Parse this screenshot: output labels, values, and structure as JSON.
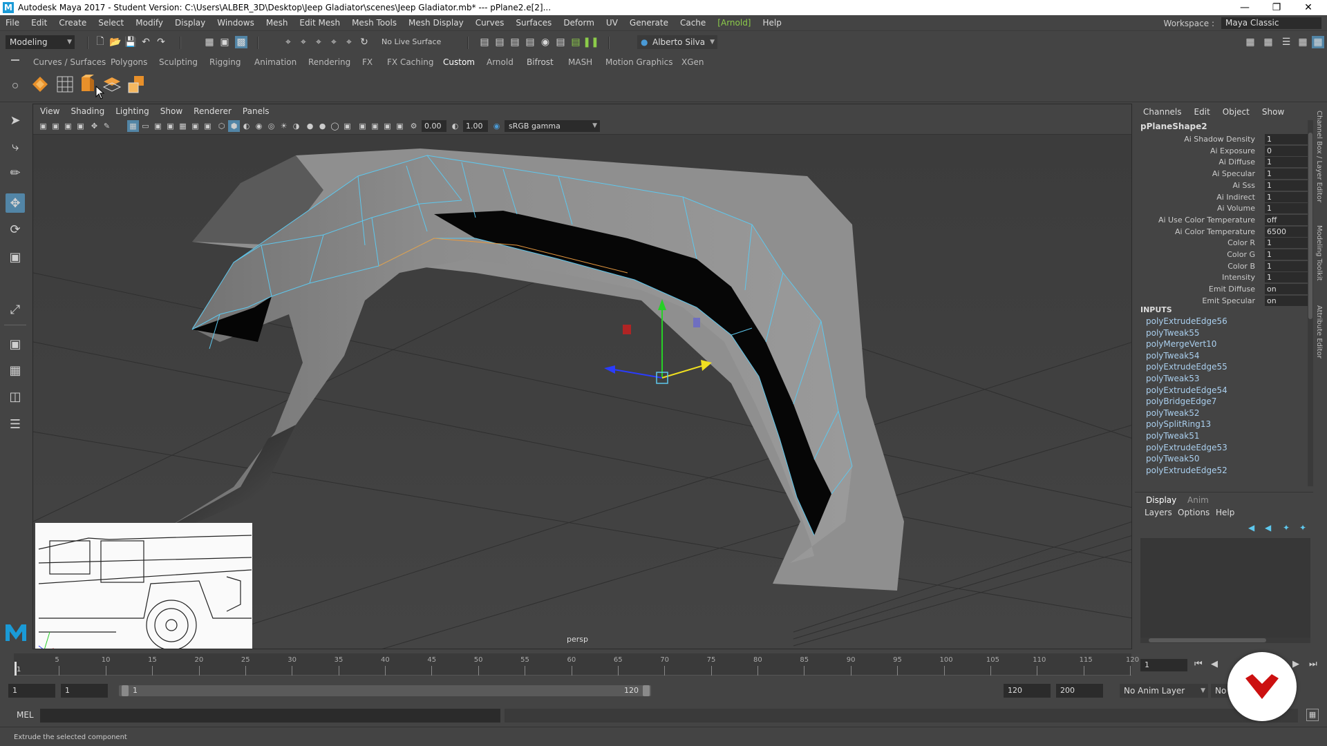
{
  "window": {
    "title": "Autodesk Maya 2017 - Student Version: C:\\Users\\ALBER_3D\\Desktop\\Jeep Gladiator\\scenes\\Jeep Gladiator.mb*  ---  pPlane2.e[2]...",
    "logo": "M"
  },
  "menubar": {
    "items": [
      "File",
      "Edit",
      "Create",
      "Select",
      "Modify",
      "Display",
      "Windows",
      "Mesh",
      "Edit Mesh",
      "Mesh Tools",
      "Mesh Display",
      "Curves",
      "Surfaces",
      "Deform",
      "UV",
      "Generate",
      "Cache",
      "[Arnold]",
      "Help"
    ],
    "workspace_label": "Workspace :",
    "workspace_value": "Maya Classic"
  },
  "statusline": {
    "mode": "Modeling",
    "live_surface": "No Live Surface",
    "user": "Alberto Silva"
  },
  "shelf": {
    "tabs": [
      "Curves / Surfaces",
      "Polygons",
      "Sculpting",
      "Rigging",
      "Animation",
      "Rendering",
      "FX",
      "FX Caching",
      "Custom",
      "Arnold",
      "Bifrost",
      "MASH",
      "Motion Graphics",
      "XGen"
    ],
    "active_tab": "Custom"
  },
  "viewport": {
    "menu": [
      "View",
      "Shading",
      "Lighting",
      "Show",
      "Renderer",
      "Panels"
    ],
    "field_a": "0.00",
    "field_b": "1.00",
    "color_space": "sRGB gamma",
    "camera_label": "persp"
  },
  "channelbox": {
    "menu": [
      "Channels",
      "Edit",
      "Object",
      "Show"
    ],
    "shape_name": "pPlaneShape2",
    "attributes": [
      {
        "name": "Ai Shadow Density",
        "value": "1"
      },
      {
        "name": "Ai Exposure",
        "value": "0"
      },
      {
        "name": "Ai Diffuse",
        "value": "1"
      },
      {
        "name": "Ai Specular",
        "value": "1"
      },
      {
        "name": "Ai Sss",
        "value": "1"
      },
      {
        "name": "Ai Indirect",
        "value": "1"
      },
      {
        "name": "Ai Volume",
        "value": "1"
      },
      {
        "name": "Ai Use Color Temperature",
        "value": "off"
      },
      {
        "name": "Ai Color Temperature",
        "value": "6500"
      },
      {
        "name": "Color R",
        "value": "1"
      },
      {
        "name": "Color G",
        "value": "1"
      },
      {
        "name": "Color B",
        "value": "1"
      },
      {
        "name": "Intensity",
        "value": "1"
      },
      {
        "name": "Emit Diffuse",
        "value": "on"
      },
      {
        "name": "Emit Specular",
        "value": "on"
      }
    ],
    "inputs_header": "INPUTS",
    "inputs": [
      "polyExtrudeEdge56",
      "polyTweak55",
      "polyMergeVert10",
      "polyTweak54",
      "polyExtrudeEdge55",
      "polyTweak53",
      "polyExtrudeEdge54",
      "polyBridgeEdge7",
      "polyTweak52",
      "polySplitRing13",
      "polyTweak51",
      "polyExtrudeEdge53",
      "polyTweak50",
      "polyExtrudeEdge52"
    ]
  },
  "sidetabs": [
    "Channel Box / Layer Editor",
    "Modeling Toolkit",
    "Attribute Editor"
  ],
  "layer_panel": {
    "tabs": [
      "Display",
      "Anim"
    ],
    "menu": [
      "Layers",
      "Options",
      "Help"
    ]
  },
  "timeslider": {
    "labels": [
      "5",
      "10",
      "15",
      "20",
      "25",
      "30",
      "35",
      "40",
      "45",
      "50",
      "55",
      "60",
      "65",
      "70",
      "75",
      "80",
      "85",
      "90",
      "95",
      "100",
      "105",
      "110",
      "115",
      "120"
    ],
    "start_marker": "1",
    "current_frame": "1"
  },
  "rangeslider": {
    "start": "1",
    "inner_start": "1",
    "bar_start": "1",
    "bar_end": "120",
    "end": "120",
    "anim_end": "200",
    "anim_layer": "No Anim Layer",
    "char_set": "No"
  },
  "cmdline": {
    "label": "MEL"
  },
  "helpline": {
    "text": "Extrude the selected component"
  },
  "colors": {
    "ui_bg": "#444444",
    "field_bg": "#2b2b2b",
    "accent": "#5285a6",
    "wire": "#5ec8ee",
    "arnold": "#8ccc4a",
    "overlay_logo": "#cc1010"
  }
}
